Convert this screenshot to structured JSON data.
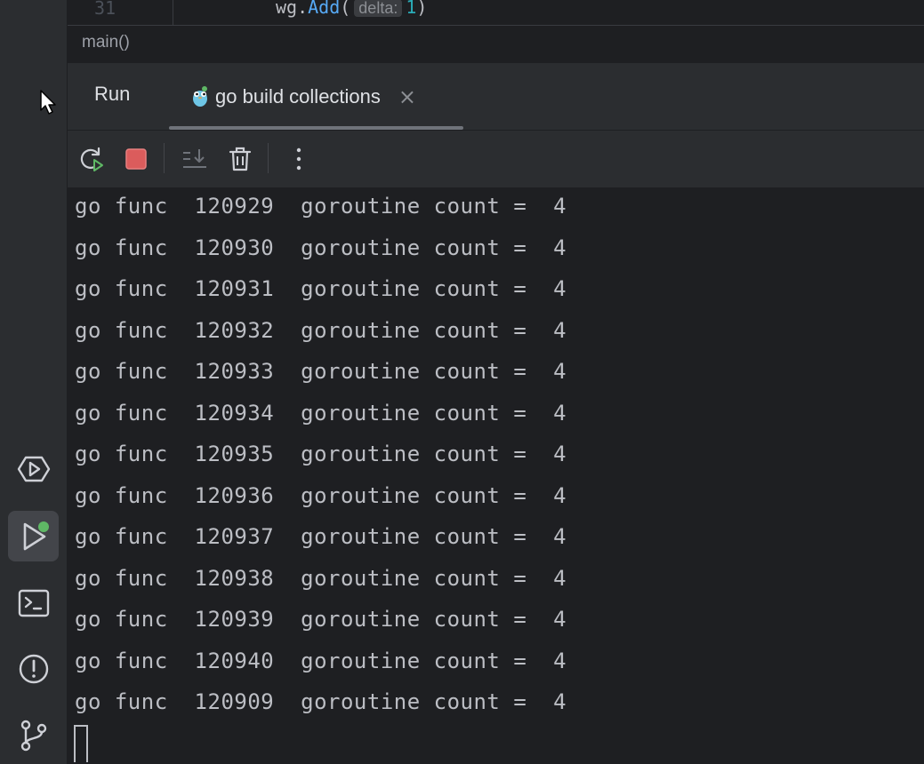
{
  "editor": {
    "line_number": "31",
    "code_receiver": "wg.",
    "code_method": "Add",
    "code_open": "(",
    "hint_label": "delta:",
    "code_arg": "1",
    "code_close": ")"
  },
  "breadcrumb": {
    "text": "main()"
  },
  "tabs": {
    "run_label": "Run",
    "active_label": "go build collections",
    "close_glyph": "×"
  },
  "toolbar": {
    "rerun": "rerun-icon",
    "stop": "stop-icon",
    "scroll_to_end": "scroll-to-end-icon",
    "clear": "trash-icon",
    "more": "more-vertical-icon"
  },
  "sidebar": {
    "items": [
      "services-icon",
      "run-icon",
      "terminal-icon",
      "problems-icon",
      "git-icon"
    ]
  },
  "console": {
    "lines": [
      "go func  120929  goroutine count =  4",
      "go func  120930  goroutine count =  4",
      "go func  120931  goroutine count =  4",
      "go func  120932  goroutine count =  4",
      "go func  120933  goroutine count =  4",
      "go func  120934  goroutine count =  4",
      "go func  120935  goroutine count =  4",
      "go func  120936  goroutine count =  4",
      "go func  120937  goroutine count =  4",
      "go func  120938  goroutine count =  4",
      "go func  120939  goroutine count =  4",
      "go func  120940  goroutine count =  4",
      "go func  120909  goroutine count =  4"
    ]
  },
  "colors": {
    "background": "#1e1f22",
    "panel": "#2b2d30",
    "text": "#bcbec4",
    "stop_red": "#db5c5c",
    "run_green": "#5fb865"
  }
}
